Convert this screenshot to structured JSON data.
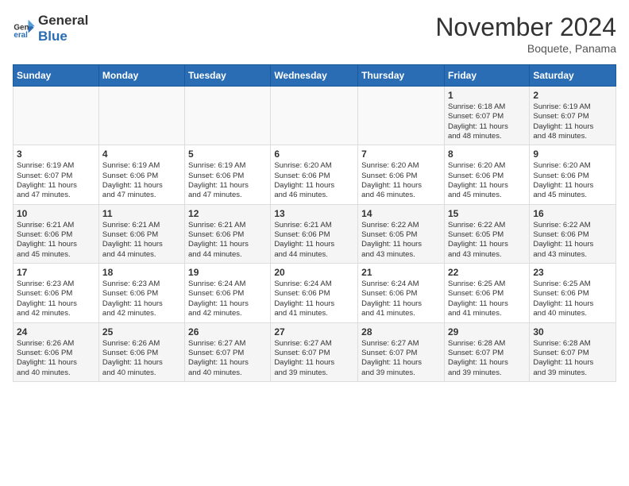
{
  "logo": {
    "general": "General",
    "blue": "Blue"
  },
  "title": "November 2024",
  "location": "Boquete, Panama",
  "days_header": [
    "Sunday",
    "Monday",
    "Tuesday",
    "Wednesday",
    "Thursday",
    "Friday",
    "Saturday"
  ],
  "weeks": [
    [
      {
        "day": "",
        "info": ""
      },
      {
        "day": "",
        "info": ""
      },
      {
        "day": "",
        "info": ""
      },
      {
        "day": "",
        "info": ""
      },
      {
        "day": "",
        "info": ""
      },
      {
        "day": "1",
        "info": "Sunrise: 6:18 AM\nSunset: 6:07 PM\nDaylight: 11 hours\nand 48 minutes."
      },
      {
        "day": "2",
        "info": "Sunrise: 6:19 AM\nSunset: 6:07 PM\nDaylight: 11 hours\nand 48 minutes."
      }
    ],
    [
      {
        "day": "3",
        "info": "Sunrise: 6:19 AM\nSunset: 6:07 PM\nDaylight: 11 hours\nand 47 minutes."
      },
      {
        "day": "4",
        "info": "Sunrise: 6:19 AM\nSunset: 6:06 PM\nDaylight: 11 hours\nand 47 minutes."
      },
      {
        "day": "5",
        "info": "Sunrise: 6:19 AM\nSunset: 6:06 PM\nDaylight: 11 hours\nand 47 minutes."
      },
      {
        "day": "6",
        "info": "Sunrise: 6:20 AM\nSunset: 6:06 PM\nDaylight: 11 hours\nand 46 minutes."
      },
      {
        "day": "7",
        "info": "Sunrise: 6:20 AM\nSunset: 6:06 PM\nDaylight: 11 hours\nand 46 minutes."
      },
      {
        "day": "8",
        "info": "Sunrise: 6:20 AM\nSunset: 6:06 PM\nDaylight: 11 hours\nand 45 minutes."
      },
      {
        "day": "9",
        "info": "Sunrise: 6:20 AM\nSunset: 6:06 PM\nDaylight: 11 hours\nand 45 minutes."
      }
    ],
    [
      {
        "day": "10",
        "info": "Sunrise: 6:21 AM\nSunset: 6:06 PM\nDaylight: 11 hours\nand 45 minutes."
      },
      {
        "day": "11",
        "info": "Sunrise: 6:21 AM\nSunset: 6:06 PM\nDaylight: 11 hours\nand 44 minutes."
      },
      {
        "day": "12",
        "info": "Sunrise: 6:21 AM\nSunset: 6:06 PM\nDaylight: 11 hours\nand 44 minutes."
      },
      {
        "day": "13",
        "info": "Sunrise: 6:21 AM\nSunset: 6:06 PM\nDaylight: 11 hours\nand 44 minutes."
      },
      {
        "day": "14",
        "info": "Sunrise: 6:22 AM\nSunset: 6:05 PM\nDaylight: 11 hours\nand 43 minutes."
      },
      {
        "day": "15",
        "info": "Sunrise: 6:22 AM\nSunset: 6:05 PM\nDaylight: 11 hours\nand 43 minutes."
      },
      {
        "day": "16",
        "info": "Sunrise: 6:22 AM\nSunset: 6:06 PM\nDaylight: 11 hours\nand 43 minutes."
      }
    ],
    [
      {
        "day": "17",
        "info": "Sunrise: 6:23 AM\nSunset: 6:06 PM\nDaylight: 11 hours\nand 42 minutes."
      },
      {
        "day": "18",
        "info": "Sunrise: 6:23 AM\nSunset: 6:06 PM\nDaylight: 11 hours\nand 42 minutes."
      },
      {
        "day": "19",
        "info": "Sunrise: 6:24 AM\nSunset: 6:06 PM\nDaylight: 11 hours\nand 42 minutes."
      },
      {
        "day": "20",
        "info": "Sunrise: 6:24 AM\nSunset: 6:06 PM\nDaylight: 11 hours\nand 41 minutes."
      },
      {
        "day": "21",
        "info": "Sunrise: 6:24 AM\nSunset: 6:06 PM\nDaylight: 11 hours\nand 41 minutes."
      },
      {
        "day": "22",
        "info": "Sunrise: 6:25 AM\nSunset: 6:06 PM\nDaylight: 11 hours\nand 41 minutes."
      },
      {
        "day": "23",
        "info": "Sunrise: 6:25 AM\nSunset: 6:06 PM\nDaylight: 11 hours\nand 40 minutes."
      }
    ],
    [
      {
        "day": "24",
        "info": "Sunrise: 6:26 AM\nSunset: 6:06 PM\nDaylight: 11 hours\nand 40 minutes."
      },
      {
        "day": "25",
        "info": "Sunrise: 6:26 AM\nSunset: 6:06 PM\nDaylight: 11 hours\nand 40 minutes."
      },
      {
        "day": "26",
        "info": "Sunrise: 6:27 AM\nSunset: 6:07 PM\nDaylight: 11 hours\nand 40 minutes."
      },
      {
        "day": "27",
        "info": "Sunrise: 6:27 AM\nSunset: 6:07 PM\nDaylight: 11 hours\nand 39 minutes."
      },
      {
        "day": "28",
        "info": "Sunrise: 6:27 AM\nSunset: 6:07 PM\nDaylight: 11 hours\nand 39 minutes."
      },
      {
        "day": "29",
        "info": "Sunrise: 6:28 AM\nSunset: 6:07 PM\nDaylight: 11 hours\nand 39 minutes."
      },
      {
        "day": "30",
        "info": "Sunrise: 6:28 AM\nSunset: 6:07 PM\nDaylight: 11 hours\nand 39 minutes."
      }
    ]
  ]
}
